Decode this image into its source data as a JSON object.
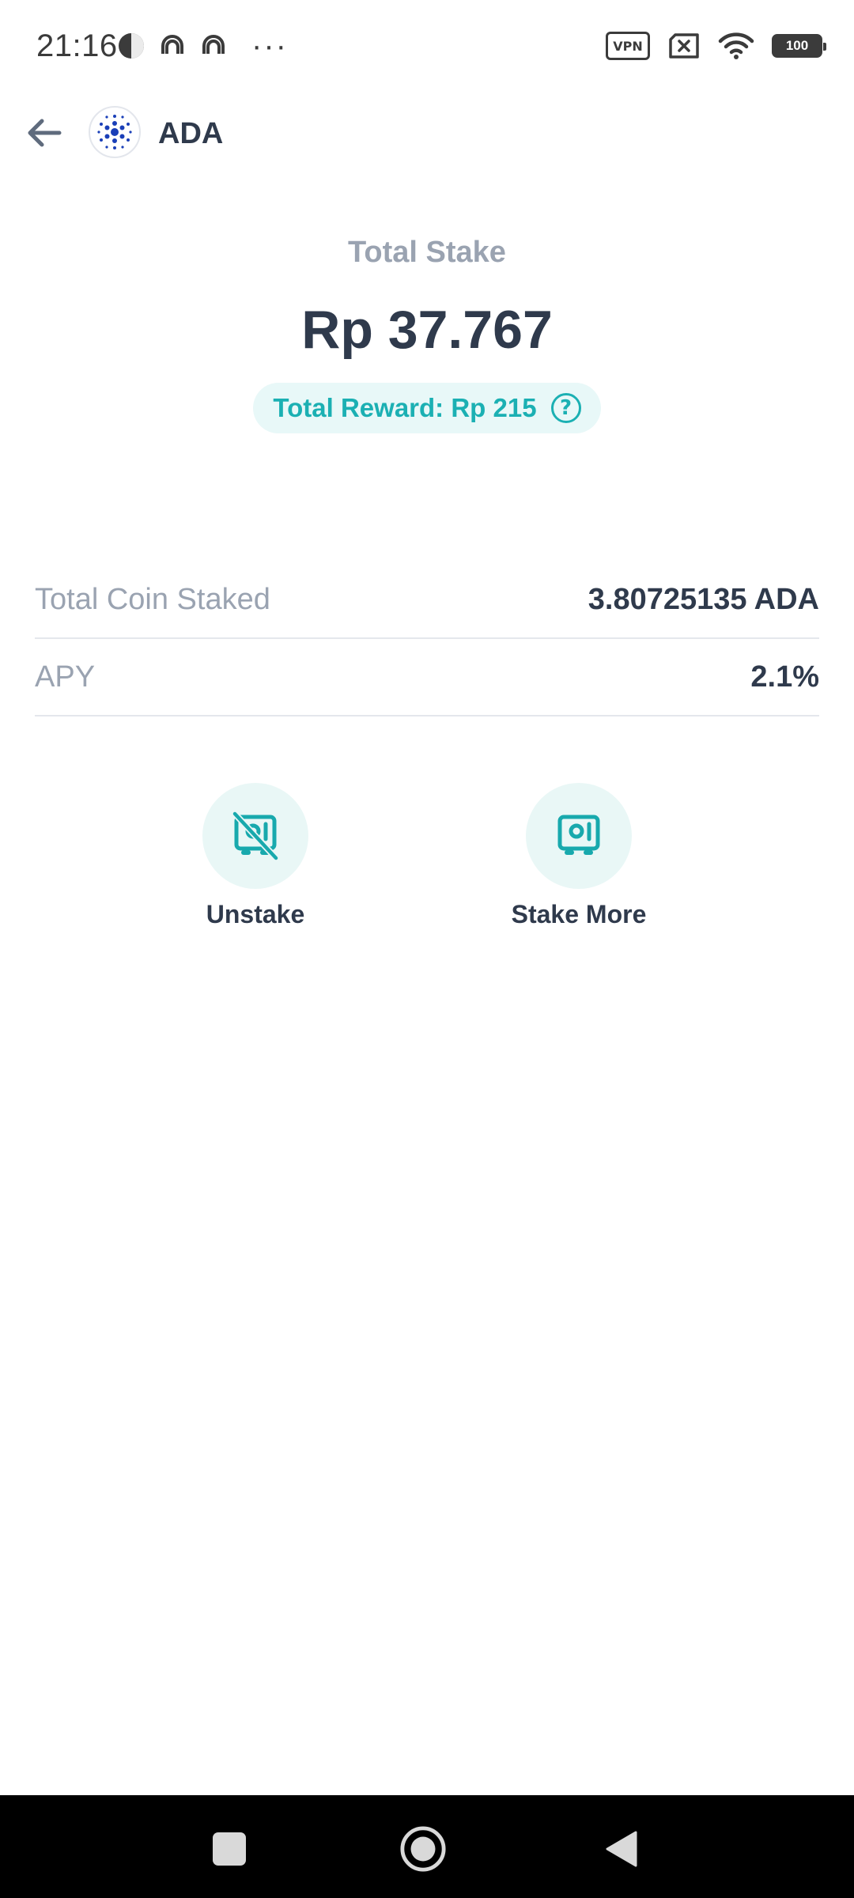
{
  "status_bar": {
    "time": "21:16",
    "more_indicator": "···",
    "vpn_label": "VPN",
    "battery_level": "100"
  },
  "header": {
    "title": "ADA",
    "back_icon": "arrow-left-icon",
    "coin_icon": "cardano-logo-icon"
  },
  "summary": {
    "label": "Total Stake",
    "value": "Rp 37.767",
    "reward": "Total Reward: Rp 215",
    "help_icon": "question-circle-icon"
  },
  "details": [
    {
      "label": "Total Coin Staked",
      "value": "3.80725135 ADA"
    },
    {
      "label": "APY",
      "value": "2.1%"
    }
  ],
  "actions": [
    {
      "label": "Unstake",
      "icon": "safe-off-icon"
    },
    {
      "label": "Stake More",
      "icon": "safe-icon"
    }
  ],
  "colors": {
    "accent": "#1bb0b3",
    "accent_bg": "#e8f8f8",
    "text_primary": "#2f3a4c",
    "text_secondary": "#9aa3b1",
    "cardano_blue": "#1a3fb8"
  }
}
